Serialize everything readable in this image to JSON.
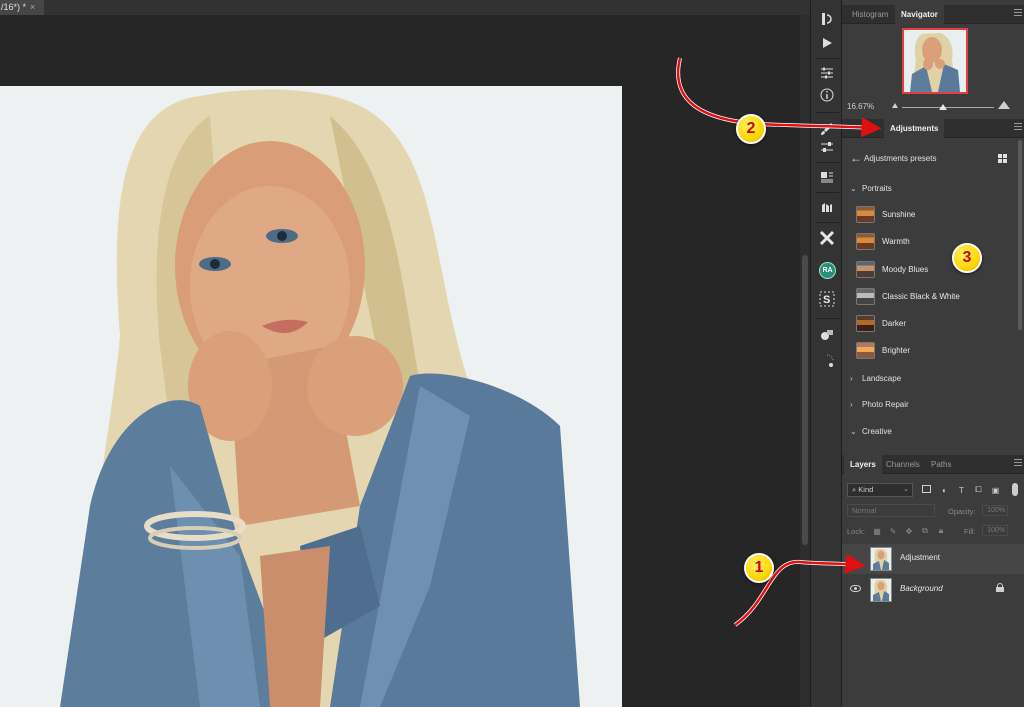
{
  "document": {
    "tab_label": "/16*) *",
    "close_glyph": "×"
  },
  "navigator_panel": {
    "tabs": [
      {
        "label": "Histogram",
        "active": false
      },
      {
        "label": "Navigator",
        "active": true
      }
    ],
    "zoom_value": "16.67%",
    "zoom_slider_level": 0.5
  },
  "adjustments_panel": {
    "tab_label": "Adjustments",
    "header_title": "Adjustments presets",
    "groups": [
      {
        "label": "Portraits",
        "expanded": true,
        "presets": [
          {
            "label": "Sunshine",
            "thumb": "warm"
          },
          {
            "label": "Warmth",
            "thumb": "warm"
          },
          {
            "label": "Moody Blues",
            "thumb": "blue"
          },
          {
            "label": "Classic Black & White",
            "thumb": "bw"
          },
          {
            "label": "Darker",
            "thumb": "dark"
          },
          {
            "label": "Brighter",
            "thumb": "bright"
          }
        ]
      },
      {
        "label": "Landscape",
        "expanded": false
      },
      {
        "label": "Photo Repair",
        "expanded": false
      },
      {
        "label": "Creative",
        "expanded": true
      }
    ]
  },
  "layers_panel": {
    "tabs": [
      {
        "label": "Layers",
        "active": true
      },
      {
        "label": "Channels",
        "active": false
      },
      {
        "label": "Paths",
        "active": false
      }
    ],
    "filter_kind": "Kind",
    "blend_mode": "Normal",
    "opacity_label": "Opacity:",
    "opacity_value": "100%",
    "lock_label": "Lock:",
    "fill_label": "Fill:",
    "fill_value": "100%",
    "layers": [
      {
        "name": "Adjustment",
        "visible": false,
        "selected": true,
        "locked": false
      },
      {
        "name": "Background",
        "visible": true,
        "selected": false,
        "locked": true
      }
    ]
  },
  "toolbar": {
    "ra_badge": "RA",
    "icons": [
      "history-brush-icon",
      "play-icon",
      "sliders-icon",
      "info-icon",
      "brush-icon",
      "properties-icon",
      "stamp-icon",
      "libraries-icon",
      "x-plugin-icon",
      "ra-plugin-icon",
      "s-plugin-icon",
      "patterns-icon",
      "progress-icon"
    ]
  },
  "annotations": [
    {
      "number": "1",
      "color": "#ffd600"
    },
    {
      "number": "2",
      "color": "#ffd600"
    },
    {
      "number": "3",
      "color": "#ffd600"
    }
  ],
  "colors": {
    "arrow_red": "#e01010",
    "thumb_border": "#e04040"
  }
}
